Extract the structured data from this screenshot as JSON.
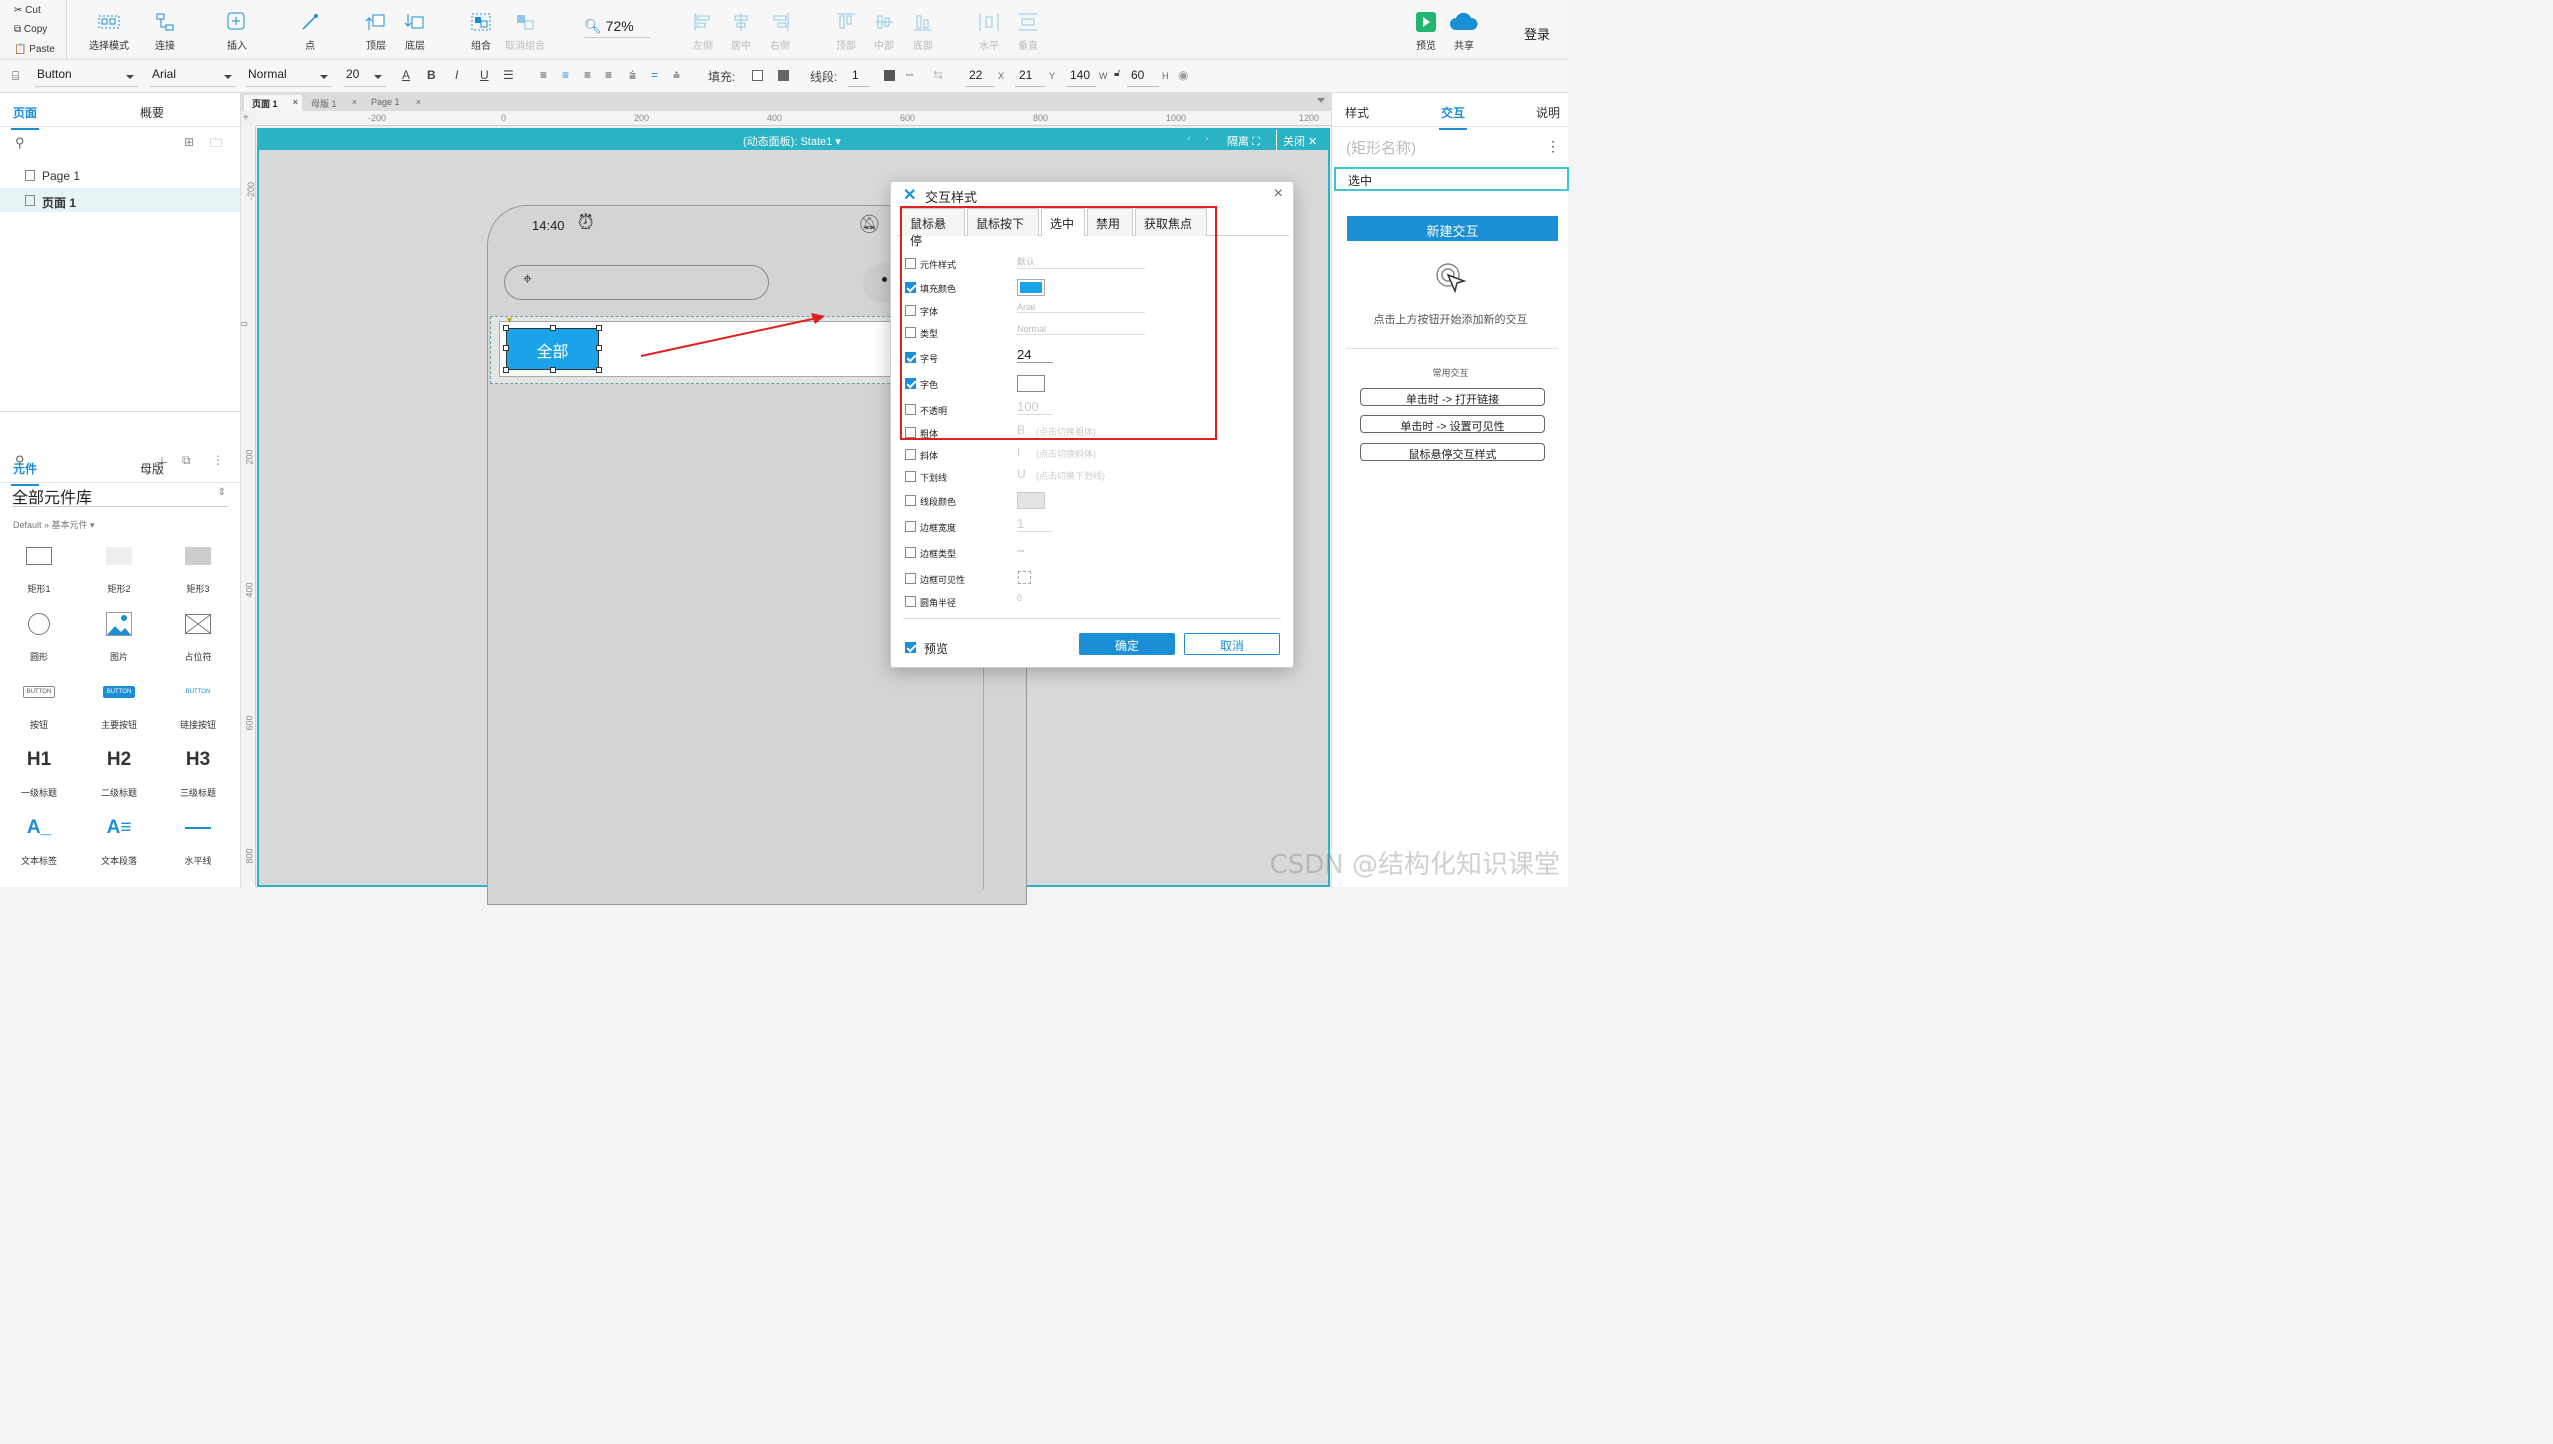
{
  "clipboard": {
    "cut": "Cut",
    "copy": "Copy",
    "paste": "Paste"
  },
  "toolbar": {
    "select_mode": "选择模式",
    "connect": "连接",
    "insert": "插入",
    "point": "点",
    "top_layer": "顶层",
    "bottom_layer": "底层",
    "group": "组合",
    "ungroup": "取消组合",
    "zoom": "72%",
    "align_left": "左侧",
    "align_center": "居中",
    "align_right": "右侧",
    "align_top": "顶部",
    "align_middle": "中部",
    "align_bottom": "底部",
    "dist_h": "水平",
    "dist_v": "垂直",
    "preview": "预览",
    "share": "共享",
    "login": "登录"
  },
  "format": {
    "widget": "Button",
    "font": "Arial",
    "weight": "Normal",
    "size": "20",
    "fill_label": "填充:",
    "line_label": "线段:",
    "line_width": "1",
    "x": "22",
    "y": "21",
    "w": "140",
    "h": "60",
    "x_label": "X",
    "y_label": "Y",
    "w_label": "W",
    "h_label": "H"
  },
  "left": {
    "tab_pages": "页面",
    "tab_outline": "概要",
    "pages": [
      "Page 1",
      "页面 1"
    ],
    "tab_widgets": "元件",
    "tab_masters": "母版",
    "library": "全部元件库",
    "library_path": "Default » 基本元件 ▾",
    "widgets": [
      {
        "label": "矩形1"
      },
      {
        "label": "矩形2"
      },
      {
        "label": "矩形3"
      },
      {
        "label": "圆形"
      },
      {
        "label": "图片"
      },
      {
        "label": "占位符"
      },
      {
        "label": "按钮",
        "glyph": "BUTTON"
      },
      {
        "label": "主要按钮",
        "glyph": "BUTTON"
      },
      {
        "label": "链接按钮",
        "glyph": "BUTTON"
      },
      {
        "label": "一级标题",
        "glyph": "H1"
      },
      {
        "label": "二级标题",
        "glyph": "H2"
      },
      {
        "label": "三级标题",
        "glyph": "H3"
      },
      {
        "label": "文本标签",
        "glyph": "A_"
      },
      {
        "label": "文本段落",
        "glyph": "A≡"
      },
      {
        "label": "水平线"
      }
    ]
  },
  "canvas": {
    "doc_tabs": [
      "页面 1",
      "母版 1",
      "Page 1"
    ],
    "ruler_h": [
      "-200",
      "0",
      "200",
      "400",
      "600",
      "800",
      "1000",
      "1200"
    ],
    "ruler_v": [
      "-200",
      "0",
      "200",
      "400",
      "600",
      "800"
    ],
    "panel_title": "(动态面板): State1",
    "isolate": "隔离",
    "close": "关闭",
    "phone_time": "14:40",
    "button_text": "全部"
  },
  "dialog": {
    "title": "交互样式",
    "tabs": [
      "鼠标悬停",
      "鼠标按下",
      "选中",
      "禁用",
      "获取焦点"
    ],
    "props": [
      {
        "label": "元件样式",
        "checked": false,
        "value": "默认"
      },
      {
        "label": "填充颜色",
        "checked": true,
        "value": ""
      },
      {
        "label": "字体",
        "checked": false,
        "value": "Arial"
      },
      {
        "label": "类型",
        "checked": false,
        "value": "Normal"
      },
      {
        "label": "字号",
        "checked": true,
        "value": "24"
      },
      {
        "label": "字色",
        "checked": true,
        "value": ""
      },
      {
        "label": "不透明",
        "checked": false,
        "value": "100"
      },
      {
        "label": "粗体",
        "checked": false,
        "value": "(点击切换粗体)"
      },
      {
        "label": "斜体",
        "checked": false,
        "value": "(点击切换斜体)"
      },
      {
        "label": "下划线",
        "checked": false,
        "value": "(点击切换下划线)"
      },
      {
        "label": "线段颜色",
        "checked": false,
        "value": ""
      },
      {
        "label": "边框宽度",
        "checked": false,
        "value": "1"
      },
      {
        "label": "边框类型",
        "checked": false,
        "value": ""
      },
      {
        "label": "边框可见性",
        "checked": false,
        "value": ""
      },
      {
        "label": "圆角半径",
        "checked": false,
        "value": "0"
      }
    ],
    "preview": "预览",
    "ok": "确定",
    "cancel": "取消",
    "fill_color": "#1aa3e8"
  },
  "right": {
    "tab_style": "样式",
    "tab_interact": "交互",
    "tab_notes": "说明",
    "name_placeholder": "(矩形名称)",
    "state": "选中",
    "new_interaction": "新建交互",
    "hint": "点击上方按钮开始添加新的交互",
    "common": "常用交互",
    "quick": [
      "单击时 -> 打开链接",
      "单击时 -> 设置可见性",
      "鼠标悬停交互样式"
    ]
  },
  "watermark": "CSDN @结构化知识课堂",
  "colors": {
    "accent": "#1a8fd6",
    "panel": "#2ab3c4",
    "highlight": "#e02020"
  }
}
